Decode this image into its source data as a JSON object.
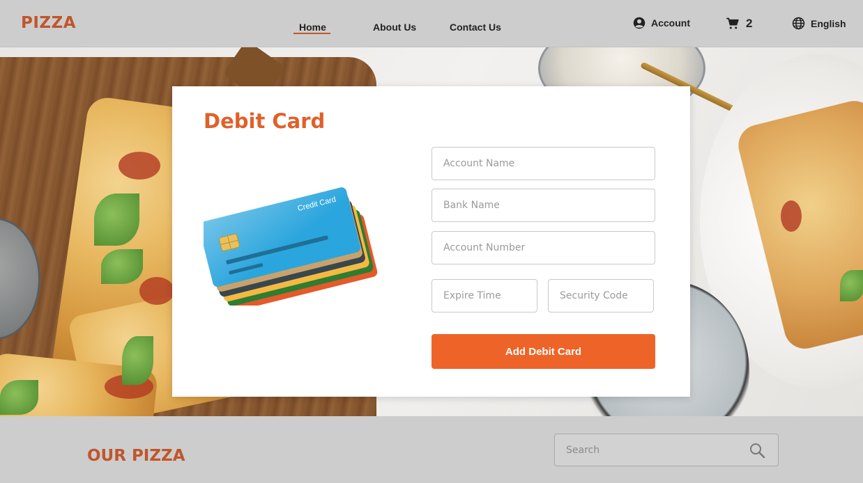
{
  "header": {
    "logo": "PIZZA",
    "nav": {
      "home": "Home",
      "about": "About Us",
      "contact": "Contact Us"
    },
    "account_label": "Account",
    "cart_count": "2",
    "language": "English"
  },
  "card": {
    "title": "Debit Card",
    "illustration_text": "Credit Card",
    "fields": {
      "account_name_placeholder": "Account Name",
      "bank_name_placeholder": "Bank Name",
      "account_number_placeholder": "Account Number",
      "expire_placeholder": "Expire Time",
      "security_placeholder": "Security Code"
    },
    "submit_label": "Add Debit Card"
  },
  "section": {
    "title": "OUR PIZZA",
    "search_placeholder": "Search"
  },
  "colors": {
    "brand_orange": "#e0602b",
    "button_orange": "#ee6428",
    "header_bg": "#cdcdcd"
  },
  "icons": {
    "account": "account-circle-icon",
    "cart": "shopping-cart-icon",
    "language": "globe-icon",
    "search": "search-icon"
  }
}
